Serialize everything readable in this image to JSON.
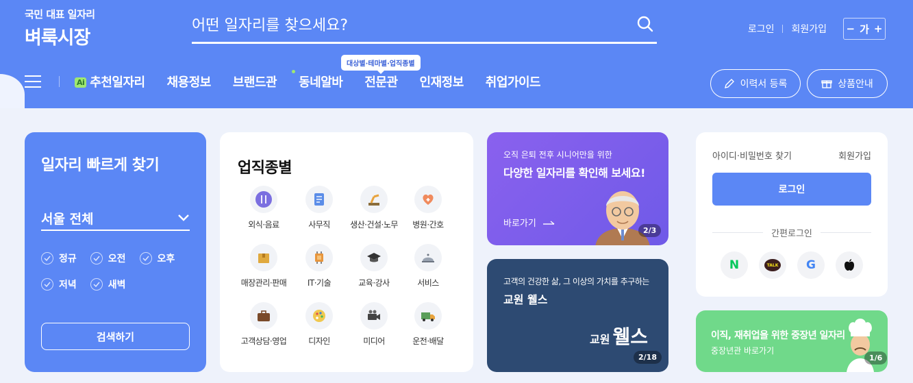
{
  "header": {
    "logo_sub": "국민 대표 일자리",
    "logo_main": "벼룩시장",
    "search_placeholder": "어떤 일자리를 찾으세요?",
    "login": "로그인",
    "signup": "회원가입",
    "font_minus": "−",
    "font_label": "가",
    "font_plus": "+",
    "nav": {
      "ai_badge": "Ai",
      "recommended": "추천일자리",
      "jobs": "채용정보",
      "brands": "브랜드관",
      "local": "동네알바",
      "specialty": "전문관",
      "talent": "인재정보",
      "guide": "취업가이드"
    },
    "specialty_tooltip": "대상별·테마별·업직종별",
    "resume_button": "이력서 등록",
    "product_button": "상품안내"
  },
  "quick": {
    "title": "일자리 빠르게 찾기",
    "region": "서울 전체",
    "options": [
      "정규",
      "오전",
      "오후",
      "저녁",
      "새벽"
    ],
    "search_button": "검색하기"
  },
  "category": {
    "title": "업직종별",
    "items": [
      {
        "label": "외식·음료",
        "icon": "restaurant-icon"
      },
      {
        "label": "사무직",
        "icon": "office-document-icon"
      },
      {
        "label": "생산·건설·노무",
        "icon": "robot-arm-icon"
      },
      {
        "label": "병원·간호",
        "icon": "medical-heart-icon"
      },
      {
        "label": "매장관리·판매",
        "icon": "shopping-box-icon"
      },
      {
        "label": "IT·기술",
        "icon": "chip-icon"
      },
      {
        "label": "교육·강사",
        "icon": "graduation-cap-icon"
      },
      {
        "label": "서비스",
        "icon": "service-bell-icon"
      },
      {
        "label": "고객상담·영업",
        "icon": "briefcase-icon"
      },
      {
        "label": "디자인",
        "icon": "palette-icon"
      },
      {
        "label": "미디어",
        "icon": "video-camera-icon"
      },
      {
        "label": "운전·배달",
        "icon": "delivery-truck-icon"
      }
    ]
  },
  "banner_senior": {
    "subtitle": "오직 은퇴 전후 시니어만을 위한",
    "title": "다양한 일자리를 확인해 보세요!",
    "link": "바로가기",
    "pager": "2/3"
  },
  "banner_wellness": {
    "subtitle": "고객의 건강한 삶, 그 이상의 가치를 추구하는",
    "title": "교원 웰스",
    "brand_small": "교원",
    "brand_big": "웰스",
    "pager": "2/18"
  },
  "login_box": {
    "find": "아이디·비밀번호 찾기",
    "signup": "회원가입",
    "login_button": "로그인",
    "easy_login": "간편로그인",
    "socials": [
      {
        "name": "naver",
        "glyph": "N",
        "color": "#03c75a"
      },
      {
        "name": "kakao",
        "glyph": "TALK",
        "color": "#3c1e1e"
      },
      {
        "name": "google",
        "glyph": "G",
        "color": "#4285f4"
      },
      {
        "name": "apple",
        "glyph": "",
        "color": "#111111"
      }
    ]
  },
  "banner_midage": {
    "title": "이직, 재취업을 위한 중장년 일자리",
    "subtitle": "중장년관 바로가기",
    "pager": "1/6"
  }
}
